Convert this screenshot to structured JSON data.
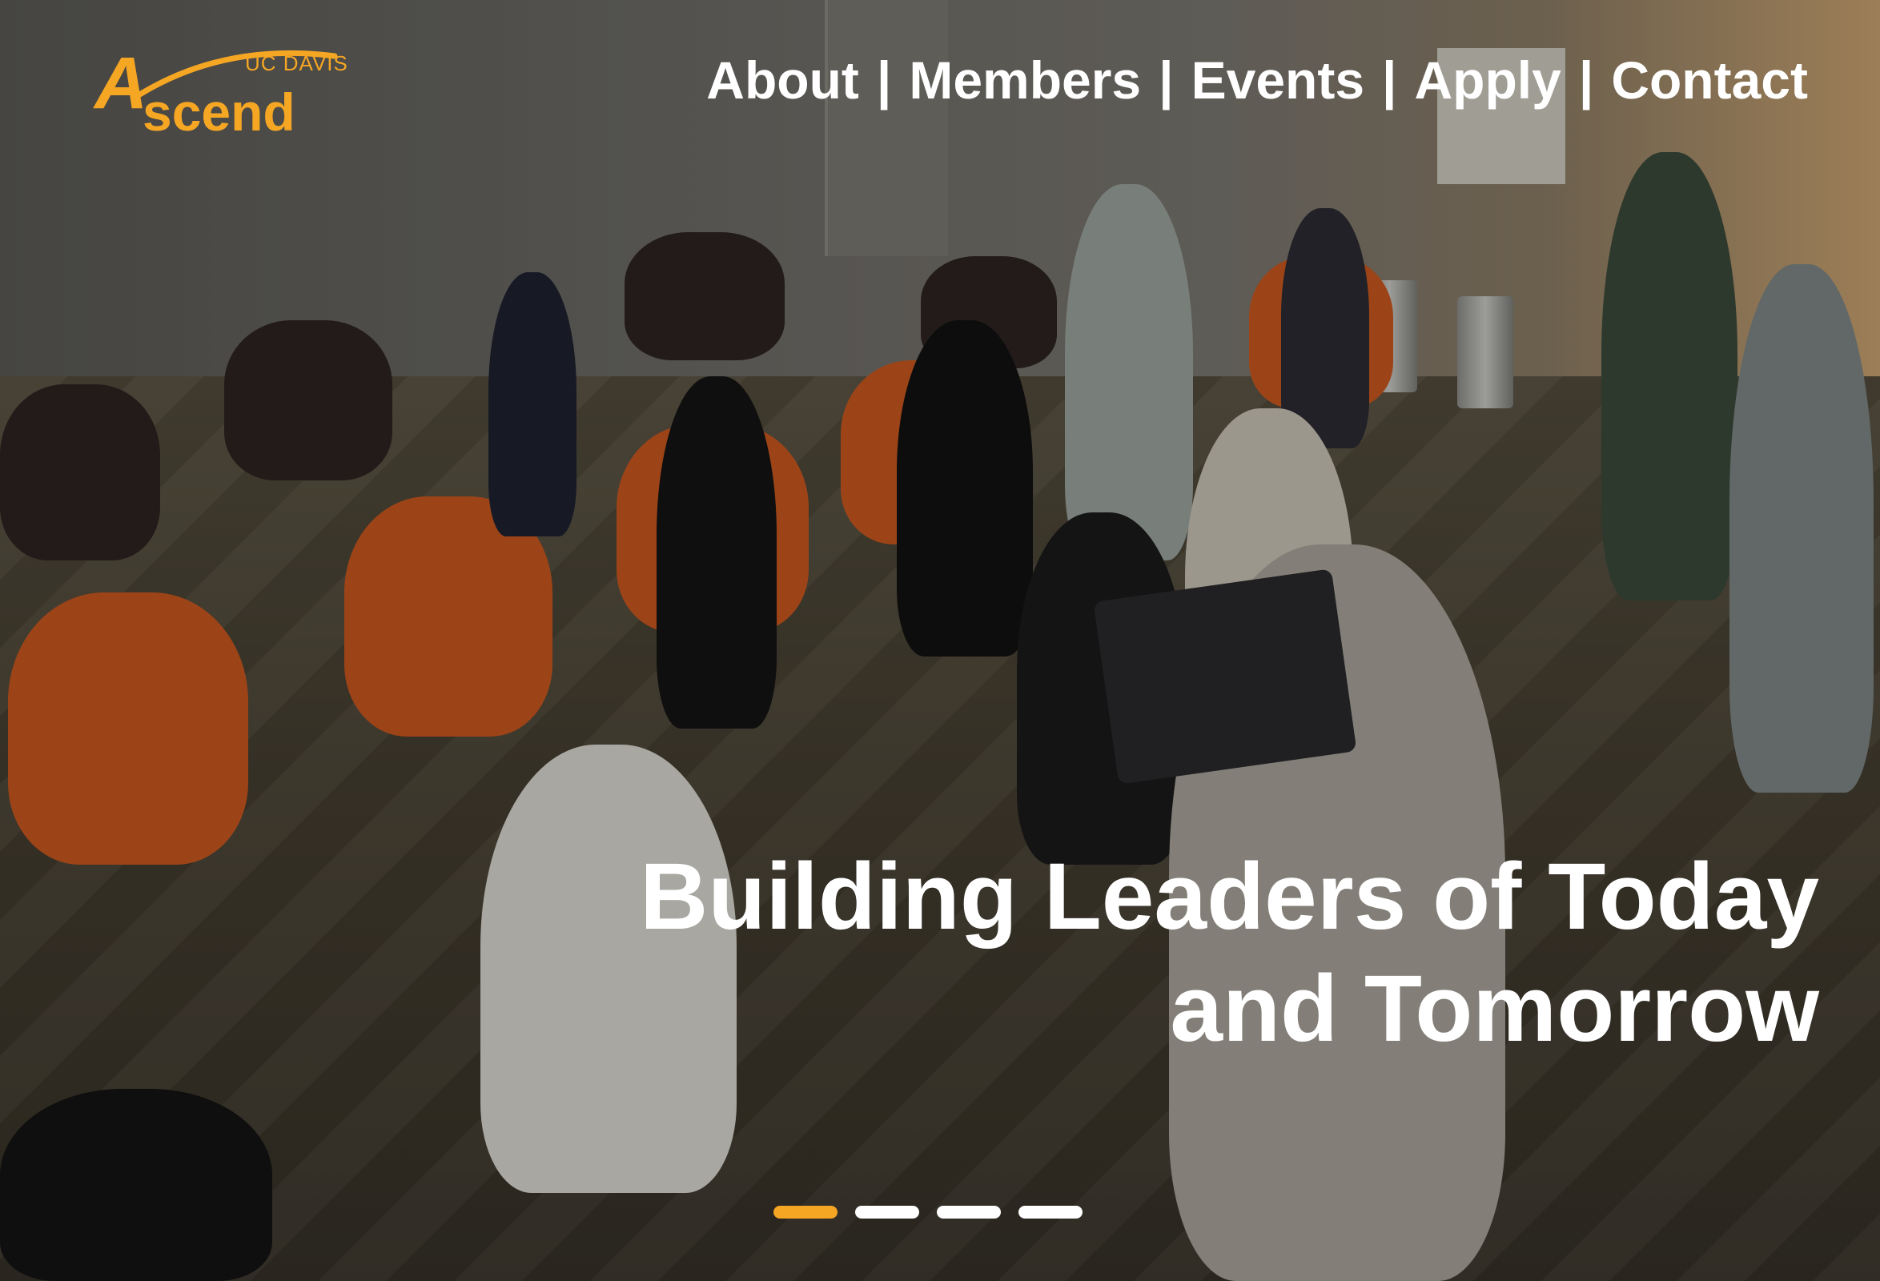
{
  "logo": {
    "mark": "A",
    "wordmark": "scend",
    "org": "UC DAVIS"
  },
  "nav": {
    "items": [
      "About",
      "Members",
      "Events",
      "Apply",
      "Contact"
    ],
    "separator": "|"
  },
  "hero": {
    "headline_line1": "Building Leaders of Today",
    "headline_line2": "and Tomorrow"
  },
  "carousel": {
    "slide_count": 4,
    "active_index": 0
  },
  "colors": {
    "brand": "#f5a623",
    "text": "#ffffff"
  }
}
